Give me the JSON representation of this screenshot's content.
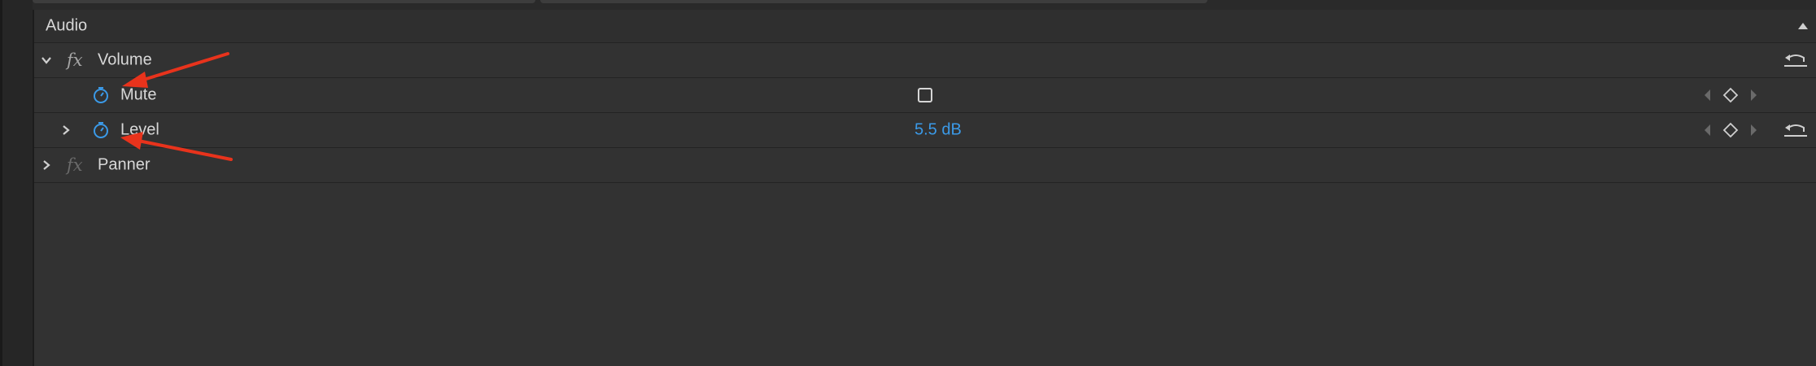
{
  "section": {
    "title": "Audio"
  },
  "effects": [
    {
      "name": "Volume",
      "expanded": true
    },
    {
      "name": "Panner",
      "expanded": false
    }
  ],
  "params": {
    "mute": {
      "label": "Mute",
      "checked": false
    },
    "level": {
      "label": "Level",
      "value": "5.5 dB"
    }
  },
  "colors": {
    "accent_blue": "#3b9ae8",
    "annotation_arrow": "#e8331c",
    "panel_bg": "#323232"
  },
  "icons": [
    "chevron-down-icon",
    "chevron-right-icon",
    "fx-icon",
    "stopwatch-icon",
    "checkbox-icon",
    "keyframe-prev-icon",
    "keyframe-add-icon",
    "keyframe-next-icon",
    "reset-icon",
    "collapse-triangle-icon",
    "arrow-annotation"
  ]
}
